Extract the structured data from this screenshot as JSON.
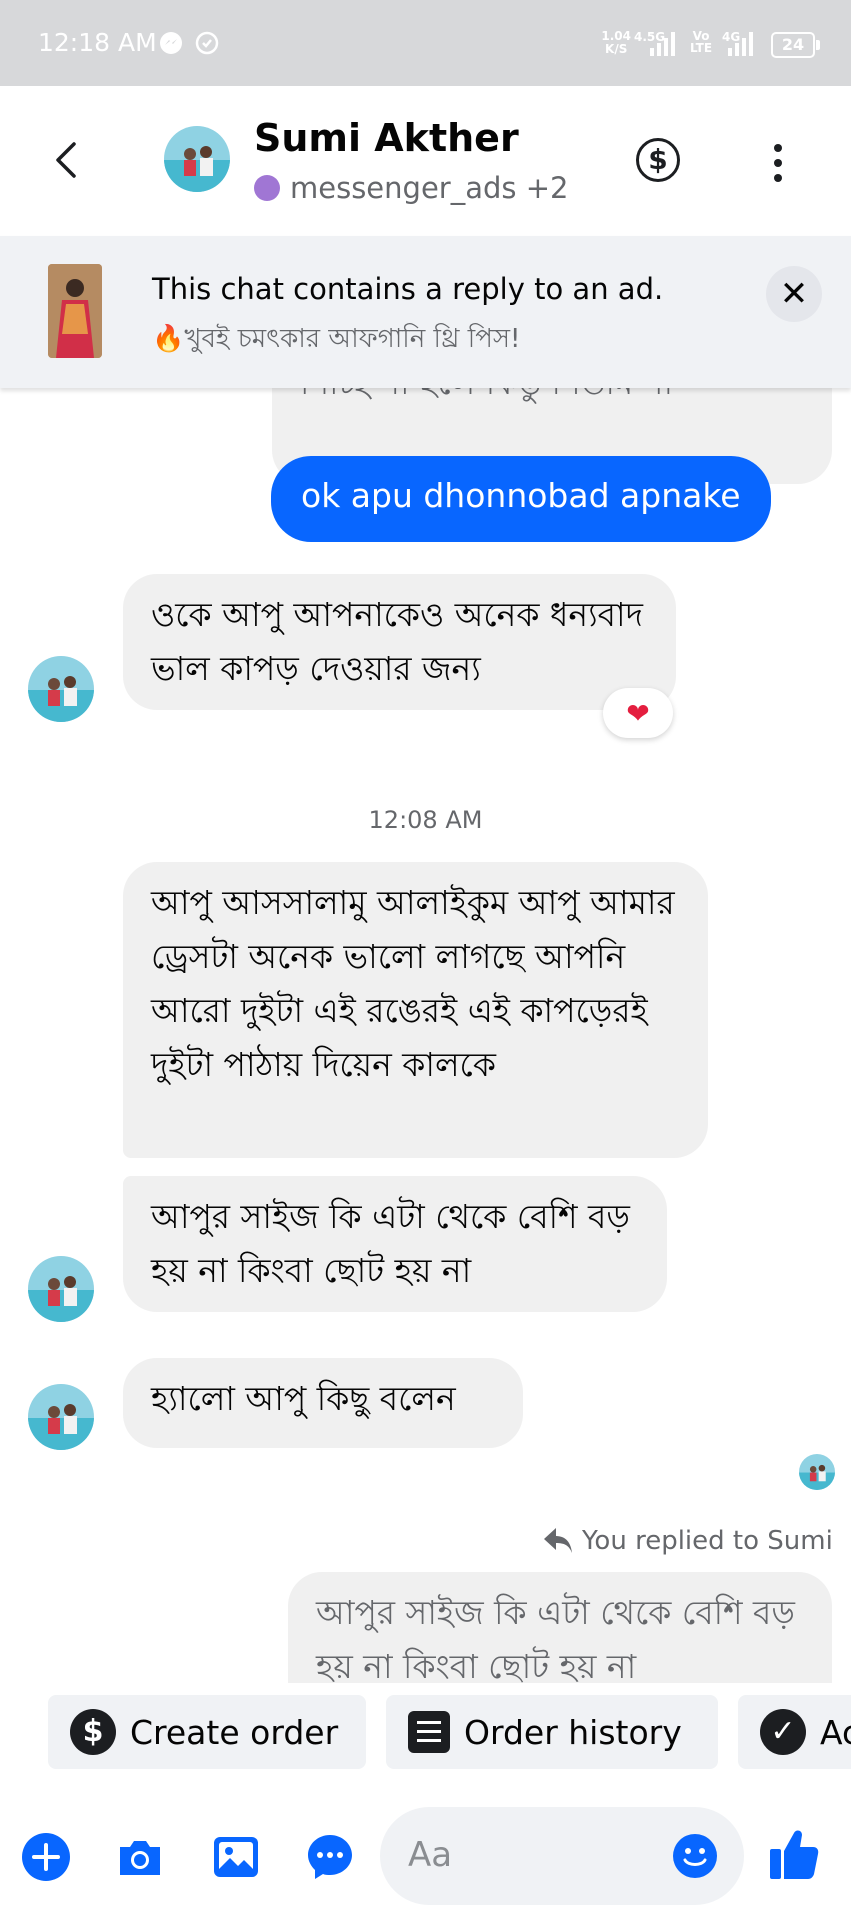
{
  "status_bar": {
    "time": "12:18 AM",
    "net_speed_top": "1.04",
    "net_speed_bottom": "K/S",
    "signal1_label": "4.5G",
    "volte_top": "Vo",
    "volte_bottom": "LTE",
    "signal2_label": "4G",
    "battery": "24"
  },
  "header": {
    "contact_name": "Sumi Akther",
    "subtitle": "messenger_ads +2"
  },
  "ad_banner": {
    "title": "This chat contains a reply to an ad.",
    "subtitle": "🔥খুবই চমৎকার আফগানি থ্রি পিস!",
    "close_symbol": "✕"
  },
  "messages": {
    "prev_partial": "নিচ্ছি না হলে কিন্তু নিতাম না",
    "out_1": "ok apu dhonnobad apnake",
    "in_1": "ওকে আপু আপনাকেও অনেক ধন্যবাদ ভাল কাপড় দেওয়ার জন্য",
    "in_1_reaction": "❤",
    "timestamp": "12:08 AM",
    "in_2": "আপু আসসালামু আলাইকুম আপু আমার ড্রেসটা অনেক ভালো লাগছে আপনি আরো দুইটা এই রঙেরই এই কাপড়েরই দুইটা পাঠায় দিয়েন কালকে",
    "in_3": "আপুর সাইজ কি এটা থেকে বেশি বড় হয় না কিংবা ছোট হয় না",
    "in_4": "হ্যালো আপু কিছু বলেন",
    "reply_note": "You replied to Sumi",
    "quoted_reply": "আপুর সাইজ কি এটা থেকে বেশি বড় হয় না কিংবা ছোট হয় না"
  },
  "quick_actions": {
    "create_order": "Create order",
    "order_history": "Order history",
    "third_partial": "Ac"
  },
  "composer": {
    "placeholder": "Aa"
  },
  "colors": {
    "accent": "#0866ff",
    "bubble_incoming": "#f0f0f0",
    "status_bar": "#d7d8da"
  },
  "icons": [
    "chevron-left-icon",
    "dollar-circle-icon",
    "kebab-menu-icon",
    "close-icon",
    "heart-icon",
    "reply-arrow-icon",
    "plus-icon",
    "camera-icon",
    "image-icon",
    "chat-bubble-icon",
    "smiley-icon",
    "thumbs-up-icon",
    "check-circle-icon",
    "list-icon"
  ]
}
